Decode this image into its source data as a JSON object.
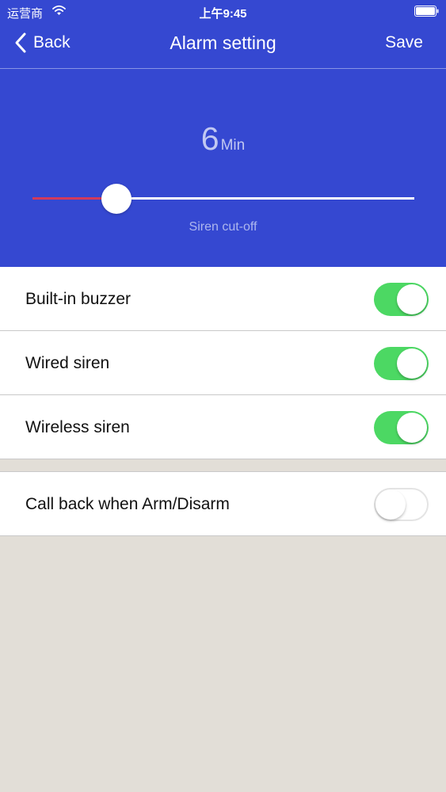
{
  "status_bar": {
    "carrier": "运营商",
    "time": "上午9:45"
  },
  "nav": {
    "back_label": "Back",
    "title": "Alarm setting",
    "save_label": "Save"
  },
  "siren_cutoff": {
    "value": "6",
    "unit": "Min",
    "caption": "Siren cut-off",
    "slider_fraction": 0.22
  },
  "settings": [
    {
      "label": "Built-in buzzer",
      "on": true
    },
    {
      "label": "Wired siren",
      "on": true
    },
    {
      "label": "Wireless siren",
      "on": true
    }
  ],
  "settings_2": [
    {
      "label": "Call back when Arm/Disarm",
      "on": false
    }
  ],
  "colors": {
    "header_blue": "#3548d1",
    "slider_fill": "#d23a5b",
    "toggle_on": "#4cd863",
    "page_background": "#e2ded7"
  }
}
